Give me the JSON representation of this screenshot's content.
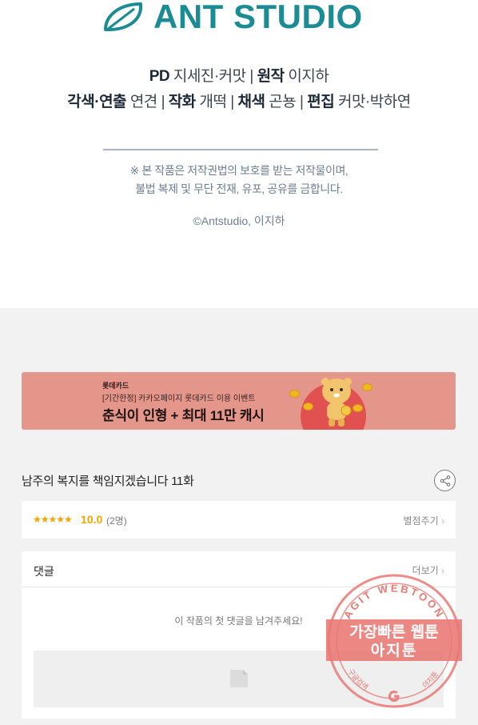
{
  "brand": {
    "name": "ANT STUDIO",
    "color": "#1b8c93"
  },
  "credits": {
    "line1": [
      {
        "role": "PD",
        "names": "지세진·커맛"
      },
      {
        "role": "원작",
        "names": "이지하"
      }
    ],
    "line2": [
      {
        "role": "각색·연출",
        "names": "연견"
      },
      {
        "role": "작화",
        "names": "개떡"
      },
      {
        "role": "채색",
        "names": "곤뇽"
      },
      {
        "role": "편집",
        "names": "커맛·박하연"
      }
    ],
    "separator": "|"
  },
  "notice": {
    "line1": "※ 본 작품은 저작권법의 보호를 받는 저작물이며,",
    "line2": "불법 복제 및 무단 전재, 유포, 공유를 금합니다."
  },
  "copyright": "©Antstudio, 이지하",
  "banner": {
    "brand": "롯데카드",
    "subtitle": "[기간한정] 카카오페이지 롯데카드 이용 이벤트",
    "title": "춘식이 인형 + 최대 11만 캐시",
    "bg_color": "#e5968a"
  },
  "episode": {
    "title": "남주의 복지를 책임지겠습니다 11화"
  },
  "rating": {
    "stars": "★★★★★",
    "score": "10.0",
    "votes": "(2명)",
    "rate_label": "별점주기",
    "chevron": "›"
  },
  "comments": {
    "label": "댓글",
    "more_label": "더보기",
    "chevron": "›",
    "empty_text": "이 작품의 첫 댓글을 남겨주세요!"
  },
  "watermark": {
    "arc_top": "AGIT WEBTOON",
    "line1": "가장빠른 웹툰",
    "line2": "아지툰",
    "arc_bottom_left": "구글검색",
    "arc_bottom_right": "아지툰",
    "color": "#e87873"
  }
}
